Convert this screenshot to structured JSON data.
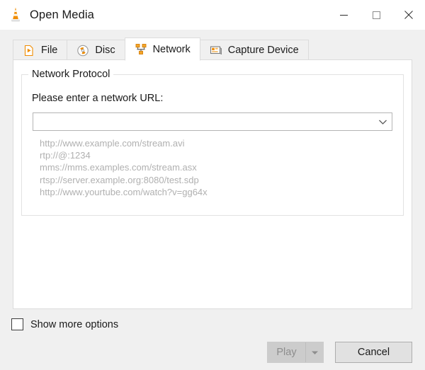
{
  "window": {
    "title": "Open Media",
    "app_icon": "vlc-cone-icon",
    "controls": {
      "minimize": "minimize-icon",
      "maximize": "maximize-icon",
      "close": "close-icon"
    }
  },
  "tabs": [
    {
      "label": "File",
      "icon": "file-play-icon",
      "active": false
    },
    {
      "label": "Disc",
      "icon": "disc-icon",
      "active": false
    },
    {
      "label": "Network",
      "icon": "network-tree-icon",
      "active": true
    },
    {
      "label": "Capture Device",
      "icon": "capture-card-icon",
      "active": false
    }
  ],
  "network_panel": {
    "group_title": "Network Protocol",
    "url_label": "Please enter a network URL:",
    "url_value": "",
    "url_placeholder": "",
    "dropdown_icon": "chevron-down-icon",
    "examples": [
      "http://www.example.com/stream.avi",
      "rtp://@:1234",
      "mms://mms.examples.com/stream.asx",
      "rtsp://server.example.org:8080/test.sdp",
      "http://www.yourtube.com/watch?v=gg64x"
    ]
  },
  "footer": {
    "show_more_options_label": "Show more options",
    "show_more_options_checked": false,
    "play_label": "Play",
    "play_enabled": false,
    "play_dropdown_icon": "caret-down-icon",
    "cancel_label": "Cancel"
  },
  "colors": {
    "accent_orange": "#f08c00",
    "window_bg": "#f0f0f0",
    "panel_bg": "#ffffff",
    "text": "#1a1a1a",
    "example_text": "#b0b0b0",
    "disabled_text": "#8d8d8d",
    "border": "#dcdcdc"
  }
}
